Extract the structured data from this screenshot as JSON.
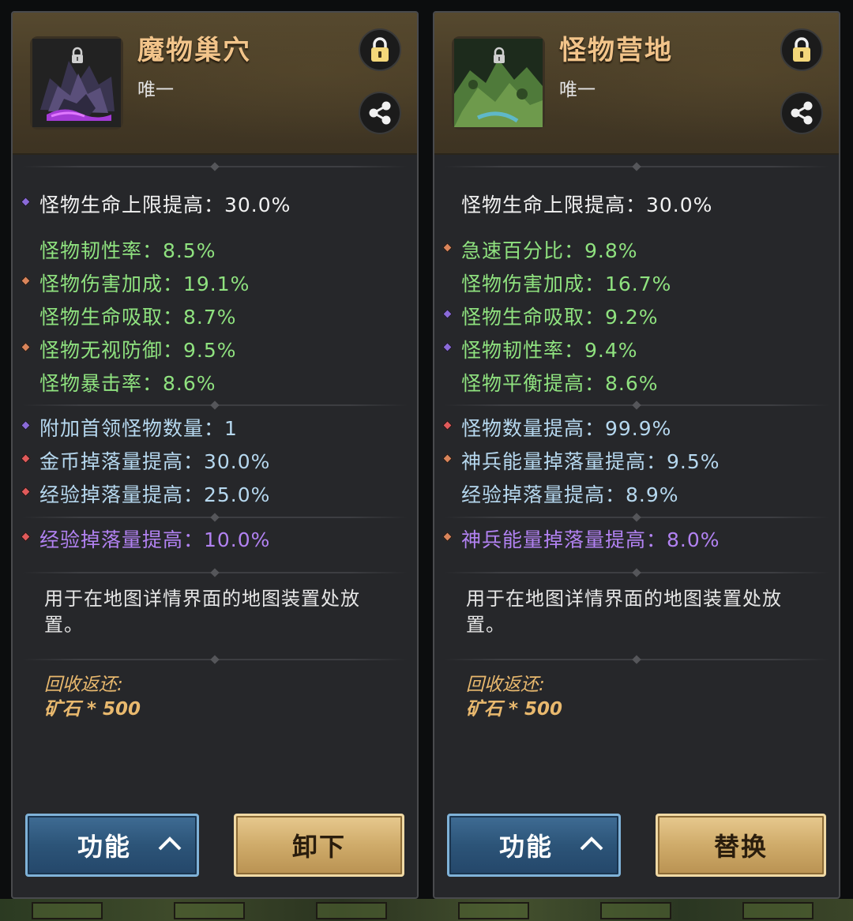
{
  "panels": [
    {
      "title": "魔物巢穴",
      "subtitle": "唯一",
      "icon": "dark-crystal-lair-icon",
      "primary": {
        "text": "怪物生命上限提高：30.0%",
        "marker": "#8a6ad8"
      },
      "group1": [
        {
          "text": "怪物韧性率：8.5%",
          "marker": ""
        },
        {
          "text": "怪物伤害加成：19.1%",
          "marker": "#d9845a"
        },
        {
          "text": "怪物生命吸取：8.7%",
          "marker": ""
        },
        {
          "text": "怪物无视防御：9.5%",
          "marker": "#d9845a"
        },
        {
          "text": "怪物暴击率：8.6%",
          "marker": ""
        }
      ],
      "group2": [
        {
          "text": "附加首领怪物数量：1",
          "marker": "#8a6ad8"
        },
        {
          "text": "金币掉落量提高：30.0%",
          "marker": "#e05a5a"
        },
        {
          "text": "经验掉落量提高：25.0%",
          "marker": "#e05a5a"
        }
      ],
      "special": {
        "text": "经验掉落量提高：10.0%",
        "marker": "#e05a5a"
      },
      "description": "用于在地图详情界面的地图装置处放置。",
      "recycle_label": "回收返还:",
      "recycle_value": "矿石 * 500",
      "function_button": "功能",
      "action_button": "卸下"
    },
    {
      "title": "怪物营地",
      "subtitle": "唯一",
      "icon": "green-camp-icon",
      "primary": {
        "text": "怪物生命上限提高：30.0%",
        "marker": ""
      },
      "group1": [
        {
          "text": "急速百分比：9.8%",
          "marker": "#d9845a"
        },
        {
          "text": "怪物伤害加成：16.7%",
          "marker": ""
        },
        {
          "text": "怪物生命吸取：9.2%",
          "marker": "#8a6ad8"
        },
        {
          "text": "怪物韧性率：9.4%",
          "marker": "#8a6ad8"
        },
        {
          "text": "怪物平衡提高：8.6%",
          "marker": ""
        }
      ],
      "group2": [
        {
          "text": "怪物数量提高：99.9%",
          "marker": "#e05a5a"
        },
        {
          "text": "神兵能量掉落量提高：9.5%",
          "marker": "#d9845a"
        },
        {
          "text": "经验掉落量提高：8.9%",
          "marker": ""
        }
      ],
      "special": {
        "text": "神兵能量掉落量提高：8.0%",
        "marker": "#d9845a"
      },
      "description": "用于在地图详情界面的地图装置处放置。",
      "recycle_label": "回收返还:",
      "recycle_value": "矿石 * 500",
      "function_button": "功能",
      "action_button": "替换"
    }
  ]
}
